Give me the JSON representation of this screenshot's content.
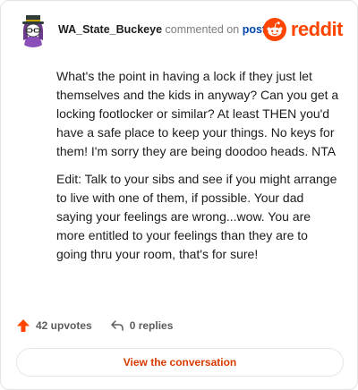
{
  "header": {
    "username": "WA_State_Buckeye",
    "action_text": "commented on",
    "post_link": "post",
    "brand": "reddit",
    "brand_color": "#ff4500"
  },
  "comment": {
    "paragraphs": [
      "What's the point in having a lock if they just let themselves and the kids in anyway? Can you get a locking footlocker or similar? At least THEN you'd have a safe place to keep your things. No keys for them! I'm sorry they are being doodoo heads. NTA",
      "Edit: Talk to your sibs and see if you might arrange to live with one of them, if possible. Your dad saying your feelings are wrong...wow. You are more entitled to your feelings than they are to going thru your room, that's for sure!"
    ]
  },
  "stats": {
    "upvotes_label": "42 upvotes",
    "replies_label": "0 replies",
    "upvote_icon": "upvote-arrow-icon",
    "reply_icon": "reply-arrow-icon"
  },
  "cta": {
    "label": "View the conversation",
    "color": "#d93a00"
  }
}
